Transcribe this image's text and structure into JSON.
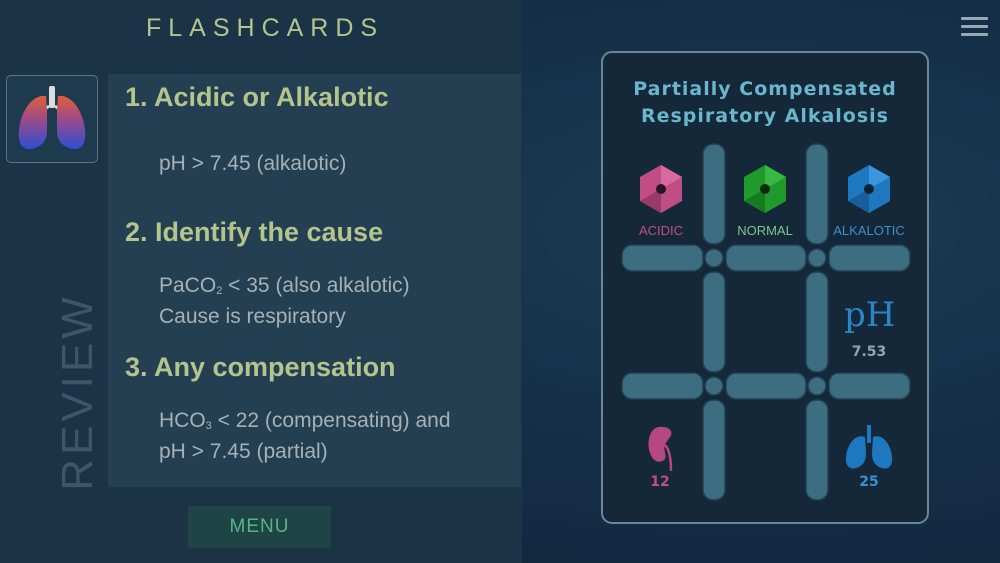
{
  "header": {
    "title": "FLASHCARDS"
  },
  "sidebar": {
    "vertical_label": "REVIEW",
    "thumbnail_icon": "lungs-icon"
  },
  "steps": [
    {
      "heading": "1. Acidic or Alkalotic",
      "line1": "pH > 7.45 (alkalotic)"
    },
    {
      "heading": "2. Identify the cause",
      "line1_prefix": "PaCO",
      "line1_sub": "2",
      "line1_suffix": " < 35 (also alkalotic)",
      "line2": "Cause is respiratory"
    },
    {
      "heading": "3. Any compensation",
      "line1_prefix": "HCO",
      "line1_sub": "3",
      "line1_suffix": " < 22 (compensating) and",
      "line2": "pH > 7.45 (partial)"
    }
  ],
  "menu_button": {
    "label": "MENU"
  },
  "top_right": {
    "menu_icon": "hamburger-icon"
  },
  "card": {
    "title_line1": "Partially Compensated",
    "title_line2": "Respiratory Alkalosis",
    "columns": [
      {
        "label": "ACIDIC",
        "icon": "hexagon-icon",
        "color": "#c04d84"
      },
      {
        "label": "NORMAL",
        "icon": "hexagon-icon",
        "color": "#1f9a2b"
      },
      {
        "label": "ALKALOTIC",
        "icon": "hexagon-icon",
        "color": "#1e78c0"
      }
    ],
    "ph": {
      "symbol": "pH",
      "value": "7.53"
    },
    "hco3": {
      "icon": "kidney-icon",
      "value": "12"
    },
    "paco2": {
      "icon": "lungs-icon",
      "value": "25"
    },
    "colors": {
      "acidic": "#c04d84",
      "normal": "#1f9a2b",
      "alkalotic": "#1e78c0",
      "grid": "#3d6d80",
      "title": "#6ab6cc"
    }
  }
}
